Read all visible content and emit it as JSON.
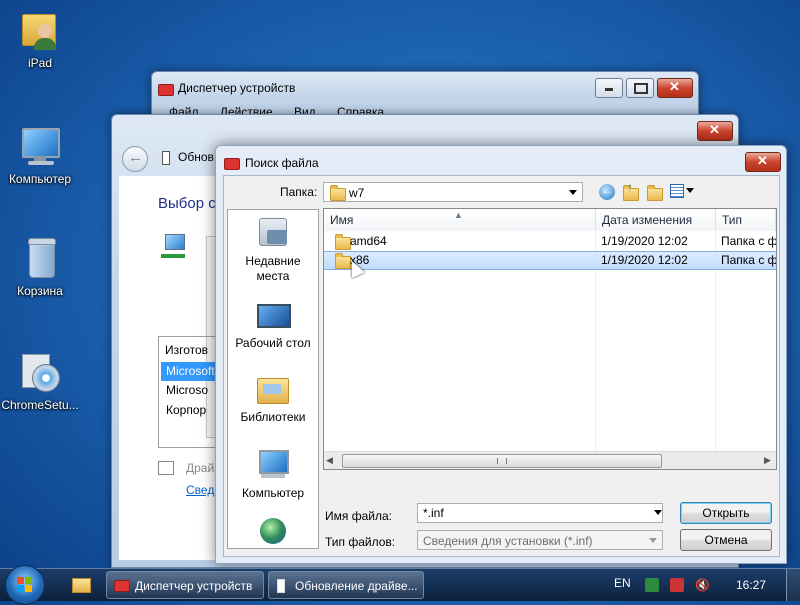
{
  "desktop": {
    "icons": [
      {
        "label": "iPad",
        "icon": "user-folder-icon"
      },
      {
        "label": "Компьютер",
        "icon": "computer-icon"
      },
      {
        "label": "Корзина",
        "icon": "recycle-bin-icon"
      },
      {
        "label": "ChromeSetu...",
        "icon": "installer-icon"
      }
    ]
  },
  "device_manager": {
    "title": "Диспетчер устройств",
    "menu": [
      "Файл",
      "Действие",
      "Вид",
      "Справка"
    ]
  },
  "update_driver": {
    "nav_title": "Обнов",
    "heading": "Выбор с",
    "list_items": [
      "Изготов",
      "Microsoft",
      "Microsо",
      "Корпор"
    ],
    "footer_text": "Драй",
    "footer_link": "Свед"
  },
  "find_file": {
    "title": "Поиск файла",
    "folder_label": "Папка:",
    "folder_value": "w7",
    "places": [
      {
        "label": "Недавние места",
        "icon": "recent-places-icon"
      },
      {
        "label": "Рабочий стол",
        "icon": "desktop-icon"
      },
      {
        "label": "Библиотеки",
        "icon": "libraries-icon"
      },
      {
        "label": "Компьютер",
        "icon": "computer-icon"
      },
      {
        "label": "",
        "icon": "network-icon"
      }
    ],
    "columns": [
      "Имя",
      "Дата изменения",
      "Тип"
    ],
    "files": [
      {
        "name": "amd64",
        "date": "1/19/2020 12:02",
        "type": "Папка с ф",
        "selected": false
      },
      {
        "name": "x86",
        "date": "1/19/2020 12:02",
        "type": "Папка с ф",
        "selected": true
      }
    ],
    "filename_label": "Имя файла:",
    "filename_value": "*.inf",
    "filetype_label": "Тип файлов:",
    "filetype_value": "Сведения для установки (*.inf)",
    "open_button": "Открыть",
    "cancel_button": "Отмена"
  },
  "taskbar": {
    "items": [
      "Диспетчер устройств",
      "Обновление драйве..."
    ],
    "language": "EN",
    "time": "16:27"
  }
}
